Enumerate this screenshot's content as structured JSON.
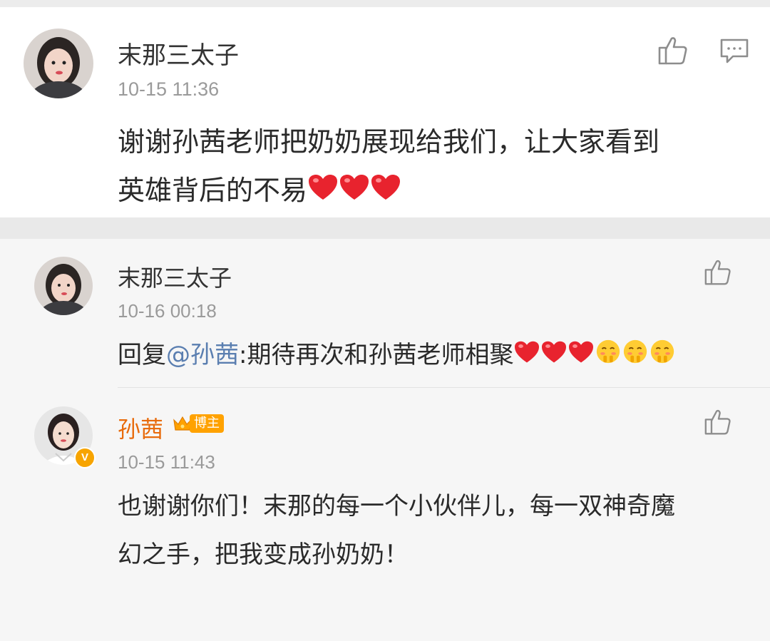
{
  "main_comment": {
    "username": "末那三太子",
    "time": "10-15 11:36",
    "text_line1": "谢谢孙茜老师把奶奶展现给我们，让大家看到",
    "text_line2": "英雄背后的不易",
    "like_icon": "thumbs-up-icon",
    "reply_icon": "comment-icon"
  },
  "replies": [
    {
      "username": "末那三太子",
      "time": "10-16 00:18",
      "reply_prefix": "回复",
      "mention": "@孙茜",
      "text": ":期待再次和孙茜老师相聚",
      "like_icon": "thumbs-up-icon"
    },
    {
      "username": "孙茜",
      "badge": "博主",
      "time": "10-15 11:43",
      "text_line1": "也谢谢你们！末那的每一个小伙伴儿，每一双神奇魔",
      "text_line2": "幻之手，把我变成孙奶奶！",
      "like_icon": "thumbs-up-icon",
      "verified_mark": "V"
    }
  ],
  "colors": {
    "host_name": "#e86b0c",
    "mention": "#5a7eb0",
    "heart": "#e8232e",
    "time": "#9a9a9a"
  }
}
